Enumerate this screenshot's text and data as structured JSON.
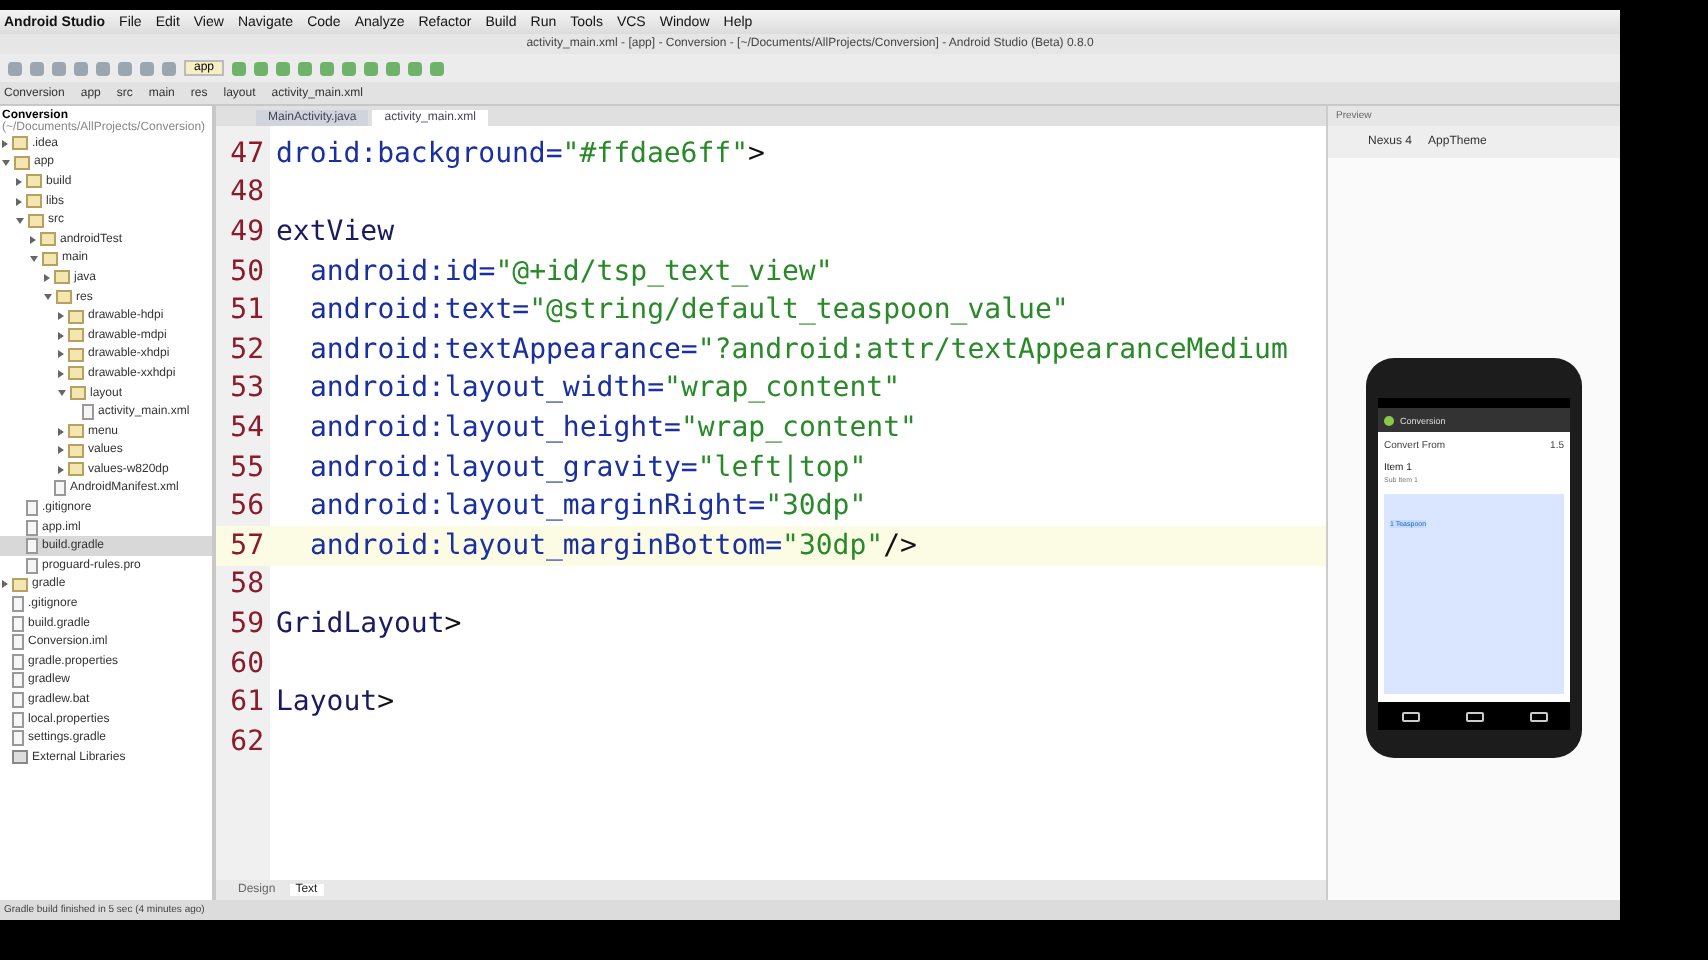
{
  "menu_bar": {
    "app": "Android Studio",
    "items": [
      "File",
      "Edit",
      "View",
      "Navigate",
      "Code",
      "Analyze",
      "Refactor",
      "Build",
      "Run",
      "Tools",
      "VCS",
      "Window",
      "Help"
    ]
  },
  "window": {
    "title": "activity_main.xml - [app] - Conversion - [~/Documents/AllProjects/Conversion] - Android Studio (Beta) 0.8.0"
  },
  "toolbar": {
    "run_config": "app"
  },
  "navigation_bar": [
    "Conversion",
    "app",
    "src",
    "main",
    "res",
    "layout",
    "activity_main.xml"
  ],
  "editor_tabs": [
    {
      "label": "MainActivity.java",
      "selected": false
    },
    {
      "label": "activity_main.xml",
      "selected": true
    }
  ],
  "project_tree": {
    "header": "Conversion",
    "path": "(~/Documents/AllProjects/Conversion)",
    "items": [
      {
        "label": ".idea",
        "kind": "folder",
        "expanded": false,
        "selected": false
      },
      {
        "label": "app",
        "kind": "module",
        "expanded": true,
        "selected": false,
        "children": [
          {
            "label": "build",
            "kind": "folder",
            "expanded": false,
            "selected": false
          },
          {
            "label": "libs",
            "kind": "folder",
            "expanded": false,
            "selected": false
          },
          {
            "label": "src",
            "kind": "folder",
            "expanded": true,
            "selected": false,
            "children": [
              {
                "label": "androidTest",
                "kind": "folder",
                "expanded": false,
                "selected": false
              },
              {
                "label": "main",
                "kind": "folder",
                "expanded": true,
                "selected": false,
                "children": [
                  {
                    "label": "java",
                    "kind": "folder",
                    "expanded": false,
                    "selected": false
                  },
                  {
                    "label": "res",
                    "kind": "folder",
                    "expanded": true,
                    "selected": false,
                    "children": [
                      {
                        "label": "drawable-hdpi",
                        "kind": "folder",
                        "expanded": false,
                        "selected": false
                      },
                      {
                        "label": "drawable-mdpi",
                        "kind": "folder",
                        "expanded": false,
                        "selected": false
                      },
                      {
                        "label": "drawable-xhdpi",
                        "kind": "folder",
                        "expanded": false,
                        "selected": false
                      },
                      {
                        "label": "drawable-xxhdpi",
                        "kind": "folder",
                        "expanded": false,
                        "selected": false
                      },
                      {
                        "label": "layout",
                        "kind": "folder",
                        "expanded": true,
                        "selected": false,
                        "children": [
                          {
                            "label": "activity_main.xml",
                            "kind": "file",
                            "selected": false
                          }
                        ]
                      },
                      {
                        "label": "menu",
                        "kind": "folder",
                        "expanded": false,
                        "selected": false
                      },
                      {
                        "label": "values",
                        "kind": "folder",
                        "expanded": false,
                        "selected": false
                      },
                      {
                        "label": "values-w820dp",
                        "kind": "folder",
                        "expanded": false,
                        "selected": false
                      }
                    ]
                  },
                  {
                    "label": "AndroidManifest.xml",
                    "kind": "file",
                    "selected": false
                  }
                ]
              }
            ]
          },
          {
            "label": ".gitignore",
            "kind": "file",
            "selected": false
          },
          {
            "label": "app.iml",
            "kind": "file",
            "selected": false
          },
          {
            "label": "build.gradle",
            "kind": "file",
            "selected": true
          },
          {
            "label": "proguard-rules.pro",
            "kind": "file",
            "selected": false
          }
        ]
      },
      {
        "label": "gradle",
        "kind": "folder",
        "expanded": false,
        "selected": false
      },
      {
        "label": ".gitignore",
        "kind": "file",
        "selected": false
      },
      {
        "label": "build.gradle",
        "kind": "file",
        "selected": false
      },
      {
        "label": "Conversion.iml",
        "kind": "file",
        "selected": false
      },
      {
        "label": "gradle.properties",
        "kind": "file",
        "selected": false
      },
      {
        "label": "gradlew",
        "kind": "file",
        "selected": false
      },
      {
        "label": "gradlew.bat",
        "kind": "file",
        "selected": false
      },
      {
        "label": "local.properties",
        "kind": "file",
        "selected": false
      },
      {
        "label": "settings.gradle",
        "kind": "file",
        "selected": false
      },
      {
        "label": "External Libraries",
        "kind": "library",
        "selected": false
      }
    ]
  },
  "editor": {
    "lines": [
      {
        "number": "47",
        "kind": "tag",
        "current": false,
        "segments": [
          {
            "kind": "attr",
            "text": "droid:background="
          },
          {
            "kind": "value",
            "text": "\"#ffdae6ff\""
          },
          {
            "kind": "plain",
            "text": ">"
          }
        ]
      },
      {
        "number": "48",
        "current": false
      },
      {
        "number": "49",
        "kind": "tag",
        "current": false,
        "segments": [
          {
            "kind": "tag",
            "text": "extView"
          }
        ]
      },
      {
        "number": "50",
        "kind": "attribute",
        "current": false,
        "segments": [
          {
            "kind": "attr",
            "text": "android:id="
          },
          {
            "kind": "value",
            "text": "\"@+id/tsp_text_view\""
          }
        ]
      },
      {
        "number": "51",
        "kind": "attribute",
        "current": false,
        "segments": [
          {
            "kind": "attr",
            "text": "android:text="
          },
          {
            "kind": "value",
            "text": "\"@string/default_teaspoon_value\""
          }
        ]
      },
      {
        "number": "52",
        "kind": "attribute",
        "current": false,
        "segments": [
          {
            "kind": "attr",
            "text": "android:textAppearance="
          },
          {
            "kind": "value",
            "text": "\"?android:attr/textAppearanceMedium"
          }
        ]
      },
      {
        "number": "53",
        "kind": "attribute",
        "current": false,
        "segments": [
          {
            "kind": "attr",
            "text": "android:layout_width="
          },
          {
            "kind": "value",
            "text": "\"wrap_content\""
          }
        ]
      },
      {
        "number": "54",
        "kind": "attribute",
        "current": false,
        "segments": [
          {
            "kind": "attr",
            "text": "android:layout_height="
          },
          {
            "kind": "value",
            "text": "\"wrap_content\""
          }
        ]
      },
      {
        "number": "55",
        "kind": "attribute",
        "current": false,
        "segments": [
          {
            "kind": "attr",
            "text": "android:layout_gravity="
          },
          {
            "kind": "value",
            "text": "\"left|top\""
          }
        ]
      },
      {
        "number": "56",
        "kind": "attribute",
        "current": false,
        "segments": [
          {
            "kind": "attr",
            "text": "android:layout_marginRight="
          },
          {
            "kind": "value",
            "text": "\"30dp\""
          }
        ]
      },
      {
        "number": "57",
        "kind": "attribute",
        "current": true,
        "segments": [
          {
            "kind": "attr",
            "text": "android:layout_marginBottom="
          },
          {
            "kind": "value",
            "text": "\"30dp\""
          },
          {
            "kind": "plain",
            "text": "/>"
          }
        ]
      },
      {
        "number": "58",
        "current": false
      },
      {
        "number": "59",
        "kind": "tag",
        "current": false,
        "segments": [
          {
            "kind": "tag",
            "text": "GridLayout"
          },
          {
            "kind": "plain",
            "text": ">"
          }
        ]
      },
      {
        "number": "60",
        "current": false
      },
      {
        "number": "61",
        "kind": "tag",
        "current": false,
        "segments": [
          {
            "kind": "tag",
            "text": "Layout"
          },
          {
            "kind": "plain",
            "text": ">"
          }
        ]
      },
      {
        "number": "62",
        "current": false
      }
    ],
    "bottom_tabs": [
      {
        "label": "Design",
        "selected": false
      },
      {
        "label": "Text",
        "selected": true
      }
    ]
  },
  "preview": {
    "title": "Preview",
    "device": "Nexus 4",
    "theme": "AppTheme",
    "phone": {
      "app_title": "Conversion",
      "heading": "Convert From",
      "value": "1.5",
      "item": "Item 1",
      "sub_item": "Sub Item 1",
      "selection": "1 Teaspoon"
    }
  },
  "status_bar": {
    "text": "Gradle build finished in 5 sec (4 minutes ago)"
  }
}
